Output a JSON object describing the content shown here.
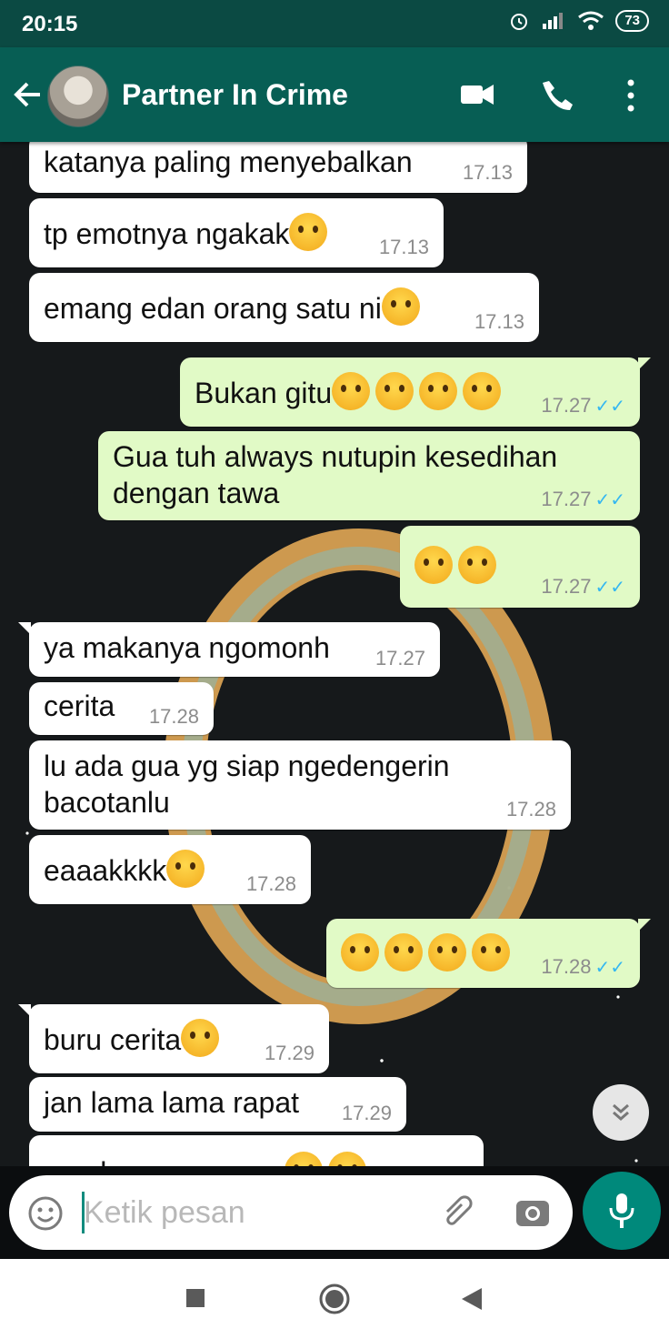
{
  "status": {
    "time": "20:15",
    "battery": "73"
  },
  "header": {
    "title": "Partner In Crime"
  },
  "messages": [
    {
      "text": "katanya paling menyebalkan",
      "time": "17.13"
    },
    {
      "text": "tp emotnya ngakak",
      "time": "17.13"
    },
    {
      "text": "emang edan orang satu ni",
      "time": "17.13"
    },
    {
      "text": "Bukan gitu",
      "time": "17.27"
    },
    {
      "text": "Gua tuh always nutupin kesedihan",
      "text2": "dengan tawa",
      "time": "17.27"
    },
    {
      "text": "",
      "time": "17.27"
    },
    {
      "text": "ya makanya ngomonh",
      "time": "17.27"
    },
    {
      "text": "cerita",
      "time": "17.28"
    },
    {
      "text": "lu ada gua yg siap ngedengerin",
      "text2": "bacotanlu",
      "time": "17.28"
    },
    {
      "text": "eaaakkkk",
      "time": "17.28"
    },
    {
      "text": "",
      "time": "17.28"
    },
    {
      "text": "buru cerita",
      "time": "17.29"
    },
    {
      "text": "jan lama lama rapat",
      "time": "17.29"
    },
    {
      "text": "gue bosen nunggu",
      "time": ""
    }
  ],
  "input": {
    "placeholder": "Ketik pesan"
  },
  "icons": {
    "back": "arrow-left-icon",
    "video": "video-call-icon",
    "call": "phone-icon",
    "more": "more-vert-icon",
    "emoji": "emoji-icon",
    "attach": "attach-icon",
    "camera": "camera-icon",
    "mic": "mic-icon"
  },
  "colors": {
    "header": "#075e54",
    "outgoing": "#e1fac6",
    "accent": "#00897b",
    "ticks": "#34b7f1"
  }
}
